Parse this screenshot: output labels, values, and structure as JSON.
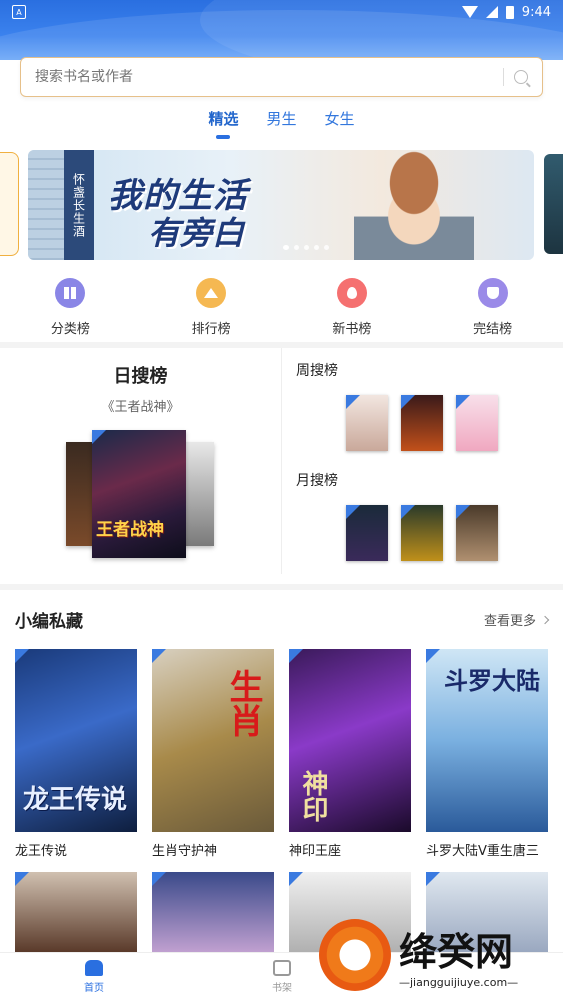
{
  "status": {
    "time": "9:44",
    "left_icon": "A"
  },
  "search": {
    "placeholder": "搜索书名或作者"
  },
  "tabs": [
    "精选",
    "男生",
    "女生"
  ],
  "banner": {
    "title_line1": "我的生活",
    "title_line2": "有旁白",
    "vertical_text": "怀盏长生酒",
    "dot_count": 5
  },
  "quick_links": [
    {
      "label": "分类榜",
      "icon": "category-icon"
    },
    {
      "label": "排行榜",
      "icon": "crown-icon"
    },
    {
      "label": "新书榜",
      "icon": "flame-icon"
    },
    {
      "label": "完结榜",
      "icon": "badge-icon"
    }
  ],
  "daily": {
    "title": "日搜榜",
    "featured": "《王者战神》",
    "cover_text": "王者战神"
  },
  "weekly": {
    "label": "周搜榜"
  },
  "monthly": {
    "label": "月搜榜"
  },
  "editor": {
    "title": "小编私藏",
    "more": "查看更多",
    "books": [
      {
        "name": "龙王传说",
        "cover_text": "龙王传说"
      },
      {
        "name": "生肖守护神",
        "cover_text": "生肖"
      },
      {
        "name": "神印王座",
        "cover_text": "神印"
      },
      {
        "name": "斗罗大陆V重生唐三",
        "cover_text": "斗罗大陆"
      }
    ]
  },
  "bottom_nav": [
    {
      "label": "首页",
      "icon": "home-icon",
      "active": true
    },
    {
      "label": "书架",
      "icon": "bookshelf-icon",
      "active": false
    }
  ],
  "watermark": {
    "big": "绛癸网",
    "small": "—jiangguijiuye.com—"
  },
  "colors": {
    "primary": "#2a6fe0",
    "search_border": "#e6c08a"
  }
}
